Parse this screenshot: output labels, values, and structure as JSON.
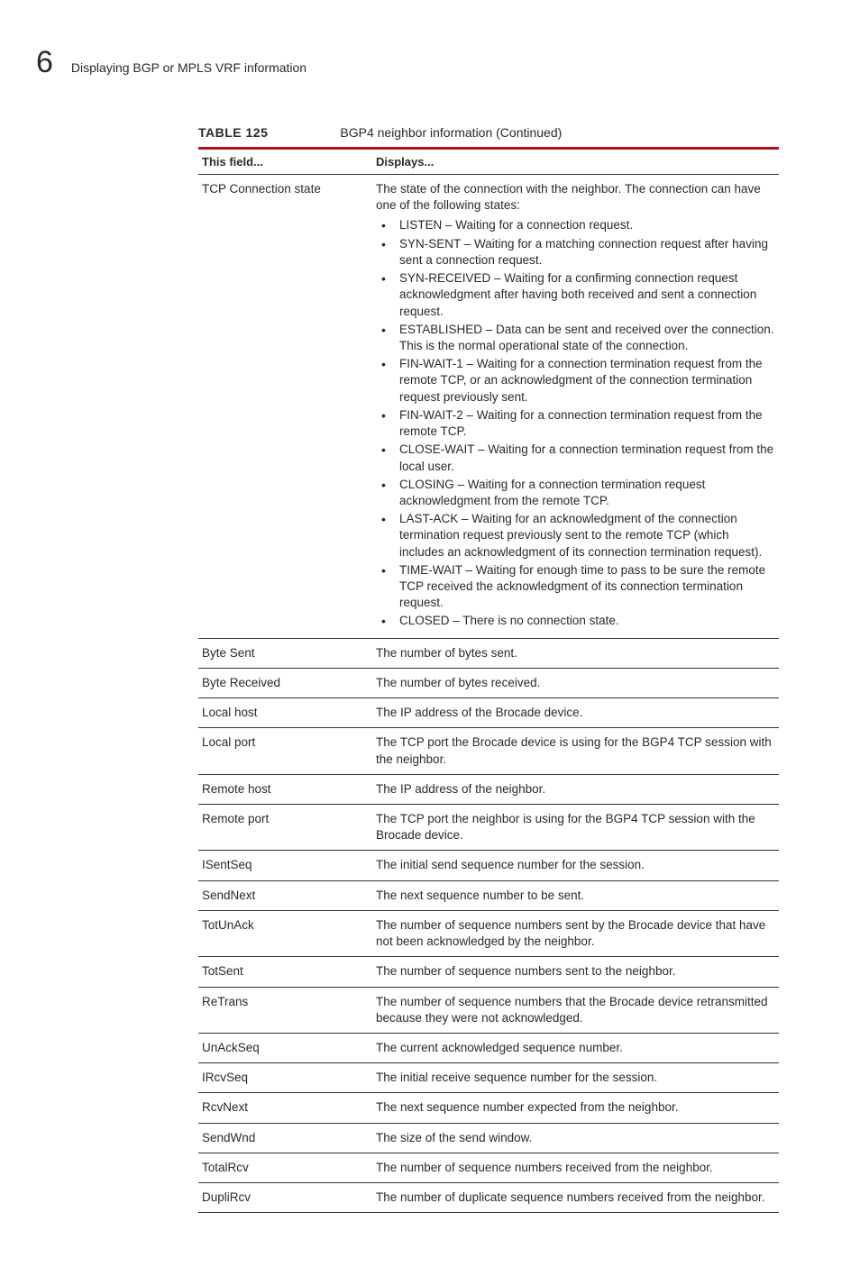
{
  "header": {
    "chapter_number": "6",
    "chapter_title": "Displaying BGP or MPLS VRF information"
  },
  "table": {
    "number": "TABLE 125",
    "title": "BGP4 neighbor information  (Continued)",
    "head_col1": "This field...",
    "head_col2": "Displays...",
    "rows": [
      {
        "field": "TCP Connection state",
        "desc_intro": "The state of the connection with the neighbor. The connection can have one of the following states:",
        "bullets": [
          "LISTEN – Waiting for a connection request.",
          "SYN-SENT – Waiting for a matching connection request after having sent a connection request.",
          "SYN-RECEIVED – Waiting for a confirming connection request acknowledgment after having both received and sent a connection request.",
          "ESTABLISHED – Data can be sent and received over the connection. This is the normal operational state of the connection.",
          "FIN-WAIT-1 – Waiting for a connection termination request from the remote TCP, or an acknowledgment of the connection termination request previously sent.",
          "FIN-WAIT-2 – Waiting for a connection termination request from the remote TCP.",
          "CLOSE-WAIT – Waiting for a connection termination request from the local user.",
          "CLOSING – Waiting for a connection termination request acknowledgment from the remote TCP.",
          "LAST-ACK – Waiting for an acknowledgment of the connection termination request previously sent to the remote TCP (which includes an acknowledgment of its connection termination request).",
          "TIME-WAIT – Waiting for enough time to pass to be sure the remote TCP received the acknowledgment of its connection termination request.",
          "CLOSED – There is no connection state."
        ]
      },
      {
        "field": "Byte Sent",
        "desc": "The number of bytes sent."
      },
      {
        "field": "Byte Received",
        "desc": "The number of bytes received."
      },
      {
        "field": "Local host",
        "desc": "The IP address of the Brocade device."
      },
      {
        "field": "Local port",
        "desc": "The TCP port the Brocade device is using for the BGP4 TCP session with the neighbor."
      },
      {
        "field": "Remote host",
        "desc": "The IP address of the neighbor."
      },
      {
        "field": "Remote port",
        "desc": "The TCP port the neighbor is using for the BGP4 TCP session with the Brocade device."
      },
      {
        "field": "ISentSeq",
        "desc": "The initial send sequence number for the session."
      },
      {
        "field": "SendNext",
        "desc": "The next sequence number to be sent."
      },
      {
        "field": "TotUnAck",
        "desc": "The number of sequence numbers sent by the Brocade device that have not been acknowledged by the neighbor."
      },
      {
        "field": "TotSent",
        "desc": "The number of sequence numbers sent to the neighbor."
      },
      {
        "field": "ReTrans",
        "desc": "The number of sequence numbers that the Brocade device retransmitted because they were not acknowledged."
      },
      {
        "field": "UnAckSeq",
        "desc": "The current acknowledged sequence number."
      },
      {
        "field": "IRcvSeq",
        "desc": "The initial receive sequence number for the session."
      },
      {
        "field": "RcvNext",
        "desc": "The next sequence number expected from the neighbor."
      },
      {
        "field": "SendWnd",
        "desc": "The size of the send window."
      },
      {
        "field": "TotalRcv",
        "desc": "The number of sequence numbers received from the neighbor."
      },
      {
        "field": "DupliRcv",
        "desc": "The number of duplicate sequence numbers received from the neighbor."
      }
    ]
  }
}
